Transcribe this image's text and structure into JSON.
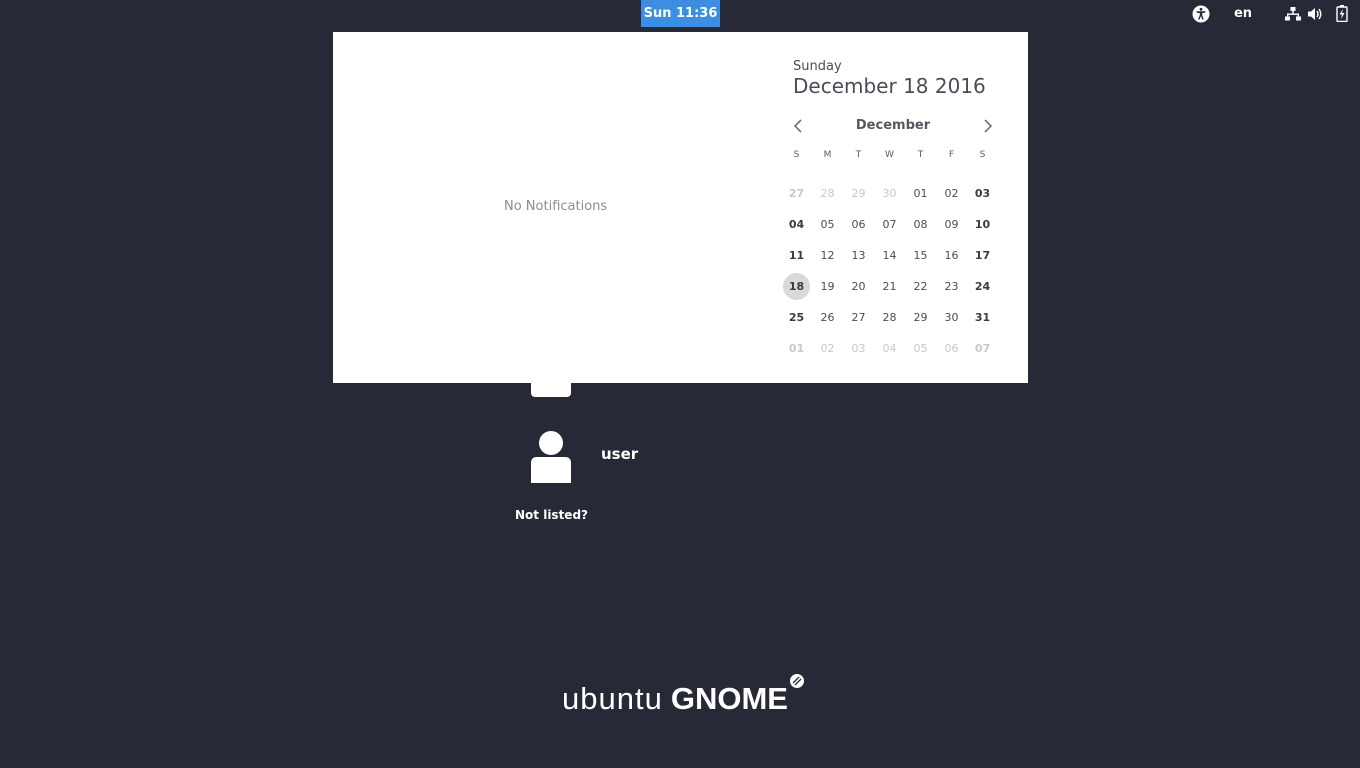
{
  "topbar": {
    "clock": "Sun 11:36",
    "language": "en",
    "icons": [
      "accessibility-icon",
      "network-icon",
      "volume-icon",
      "battery-icon"
    ]
  },
  "calendar_popover": {
    "notifications_empty": "No Notifications",
    "weekday_name": "Sunday",
    "full_date": "December 18 2016",
    "month": "December",
    "weekday_headers": [
      "S",
      "M",
      "T",
      "W",
      "T",
      "F",
      "S"
    ],
    "weeks": [
      [
        "27",
        "28",
        "29",
        "30",
        "01",
        "02",
        "03"
      ],
      [
        "04",
        "05",
        "06",
        "07",
        "08",
        "09",
        "10"
      ],
      [
        "11",
        "12",
        "13",
        "14",
        "15",
        "16",
        "17"
      ],
      [
        "18",
        "19",
        "20",
        "21",
        "22",
        "23",
        "24"
      ],
      [
        "25",
        "26",
        "27",
        "28",
        "29",
        "30",
        "31"
      ],
      [
        "01",
        "02",
        "03",
        "04",
        "05",
        "06",
        "07"
      ]
    ],
    "today": "18"
  },
  "login": {
    "user_name": "user",
    "not_listed": "Not listed?"
  },
  "logo": {
    "ubuntu": "ubuntu",
    "gnome": "GNOME"
  },
  "colors": {
    "background": "#272a36",
    "clock_highlight": "#3d8ee0",
    "popover": "#ffffff",
    "today_circle": "#d9d9d9"
  }
}
